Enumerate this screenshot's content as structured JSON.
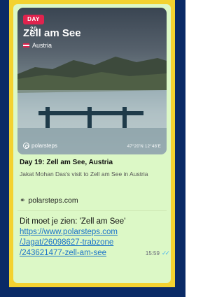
{
  "card": {
    "day_label": "DAY 20",
    "place": "Zell am See",
    "country": "Austria",
    "brand": "polarsteps",
    "coords": "47°20'N 12°48'E",
    "flag_colors": [
      "#e0234e",
      "#ffffff",
      "#e0234e"
    ]
  },
  "link_preview": {
    "title": "Day 19: Zell am See, Austria",
    "description": "Jakat Mohan Das's visit to Zell am See in Austria",
    "domain": "polarsteps.com",
    "domain_icon": "link-chain-icon"
  },
  "message": {
    "text": "Dit moet je zien: 'Zell am See'",
    "url_lines": [
      "https://www.polarsteps.com",
      "/Jagat/26098627-trabzone",
      "/243621477-zell-am-see"
    ],
    "time": "15:59",
    "status": "read",
    "colors": {
      "bubble": "#dcf8c6",
      "link": "#1a73c9",
      "ticks": "#4fb6ec"
    }
  }
}
